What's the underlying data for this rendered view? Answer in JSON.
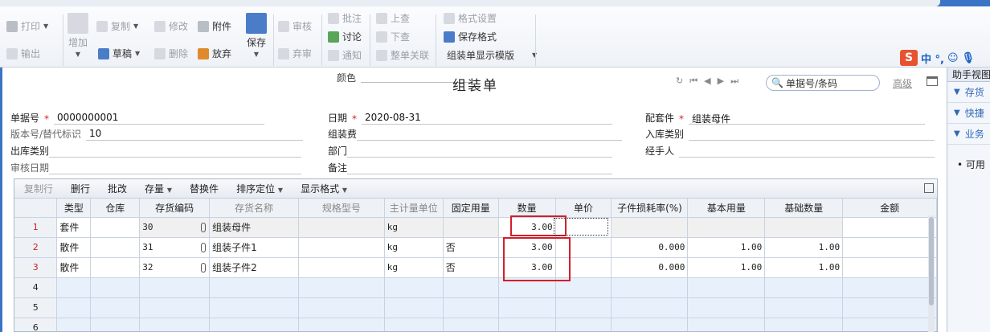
{
  "toolbar": {
    "print": "打印",
    "output": "输出",
    "add": "增加",
    "copy": "复制",
    "draft": "草稿",
    "modify": "修改",
    "delete": "删除",
    "attach": "附件",
    "discard": "放弃",
    "save": "保存",
    "audit": "审核",
    "unaudit": "弃审",
    "annotate": "批注",
    "discuss": "讨论",
    "notify": "通知",
    "lookup_up": "上查",
    "lookup_down": "下查",
    "whole_link": "整单关联",
    "format_settings": "格式设置",
    "save_format": "保存格式",
    "template": "组装单显示模版"
  },
  "ime": {
    "logo": "S",
    "text": "中 °,"
  },
  "header": {
    "color_label": "颜色",
    "title": "组装单",
    "search_placeholder": "单据号/条码",
    "advanced": "高级"
  },
  "form": {
    "doc_no_label": "单据号",
    "doc_no": "0000000001",
    "version_label": "版本号/替代标识",
    "version": "10",
    "out_type_label": "出库类别",
    "audit_date_label": "审核日期",
    "date_label": "日期",
    "date": "2020-08-31",
    "assembly_fee_label": "组装费",
    "dept_label": "部门",
    "remark_label": "备注",
    "kit_label": "配套件",
    "kit": "组装母件",
    "in_type_label": "入库类别",
    "handler_label": "经手人",
    "required_mark": "*"
  },
  "grid_toolbar": {
    "copy_row": "复制行",
    "delete_row": "删行",
    "batch_edit": "批改",
    "stock": "存量",
    "replace": "替换件",
    "sort": "排序定位",
    "display_format": "显示格式"
  },
  "columns": [
    "类型",
    "仓库",
    "存货编码",
    "存货名称",
    "规格型号",
    "主计量单位",
    "固定用量",
    "数量",
    "单价",
    "子件损耗率(%)",
    "基本用量",
    "基础数量",
    "金额"
  ],
  "rows": [
    {
      "no": "1",
      "type": "套件",
      "warehouse": "",
      "code": "30",
      "name": "组装母件",
      "spec": "",
      "unit": "kg",
      "fixed": "",
      "qty": "3.00",
      "price": "",
      "loss": "",
      "base_usage": "",
      "base_qty": "",
      "amount": ""
    },
    {
      "no": "2",
      "type": "散件",
      "warehouse": "",
      "code": "31",
      "name": "组装子件1",
      "spec": "",
      "unit": "kg",
      "fixed": "否",
      "qty": "3.00",
      "price": "",
      "loss": "0.000",
      "base_usage": "1.00",
      "base_qty": "1.00",
      "amount": ""
    },
    {
      "no": "3",
      "type": "散件",
      "warehouse": "",
      "code": "32",
      "name": "组装子件2",
      "spec": "",
      "unit": "kg",
      "fixed": "否",
      "qty": "3.00",
      "price": "",
      "loss": "0.000",
      "base_usage": "1.00",
      "base_qty": "1.00",
      "amount": ""
    }
  ],
  "empty_rows": [
    "4",
    "5",
    "6"
  ],
  "right_panel": {
    "title": "助手视图",
    "sections": [
      "存货",
      "快捷",
      "业务"
    ],
    "body": "• 可用"
  }
}
